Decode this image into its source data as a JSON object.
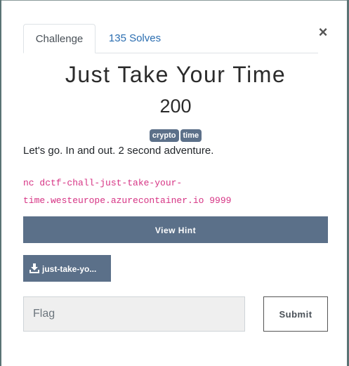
{
  "tabs": {
    "challenge": "Challenge",
    "solves": "135 Solves"
  },
  "close_label": "×",
  "challenge": {
    "name": "Just Take Your Time",
    "points": "200",
    "tags": [
      "crypto",
      "time"
    ],
    "description": "Let's go. In and out. 2 second adventure.",
    "connection_line1": "nc dctf-chall-just-take-your-",
    "connection_line2": "time.westeurope.azurecontainer.io 9999"
  },
  "hint_button": "View Hint",
  "file_button": {
    "icon": "download-icon",
    "label": "just-take-yo..."
  },
  "flag_input": {
    "placeholder": "Flag",
    "value": ""
  },
  "submit_button": "Submit",
  "colors": {
    "accent": "#5b7089",
    "link": "#2a6db0",
    "code": "#d63384"
  }
}
